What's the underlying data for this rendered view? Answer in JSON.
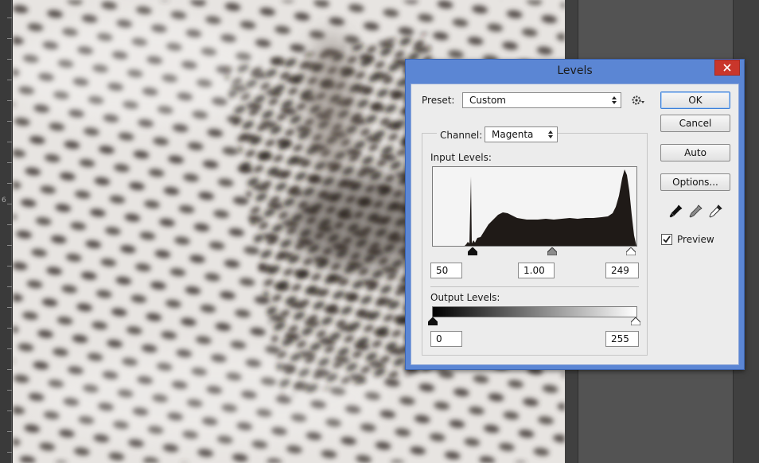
{
  "ruler": {
    "label": "6"
  },
  "dialog": {
    "title": "Levels",
    "preset": {
      "label": "Preset:",
      "value": "Custom"
    },
    "channel": {
      "label": "Channel:",
      "value": "Magenta"
    },
    "input_levels": {
      "label": "Input Levels:",
      "black": "50",
      "gamma": "1.00",
      "white": "249"
    },
    "output_levels": {
      "label": "Output Levels:",
      "black": "0",
      "white": "255"
    },
    "buttons": {
      "ok": "OK",
      "cancel": "Cancel",
      "auto": "Auto",
      "options": "Options..."
    },
    "preview": {
      "label": "Preview",
      "checked": true
    },
    "icons": [
      "gear-icon",
      "black-eyedropper-icon",
      "gray-eyedropper-icon",
      "white-eyedropper-icon",
      "close-icon",
      "checkmark-icon"
    ]
  },
  "colors": {
    "title_bar": "#5b86d4",
    "close_button": "#c9362b",
    "dialog_bg": "#ececec"
  }
}
